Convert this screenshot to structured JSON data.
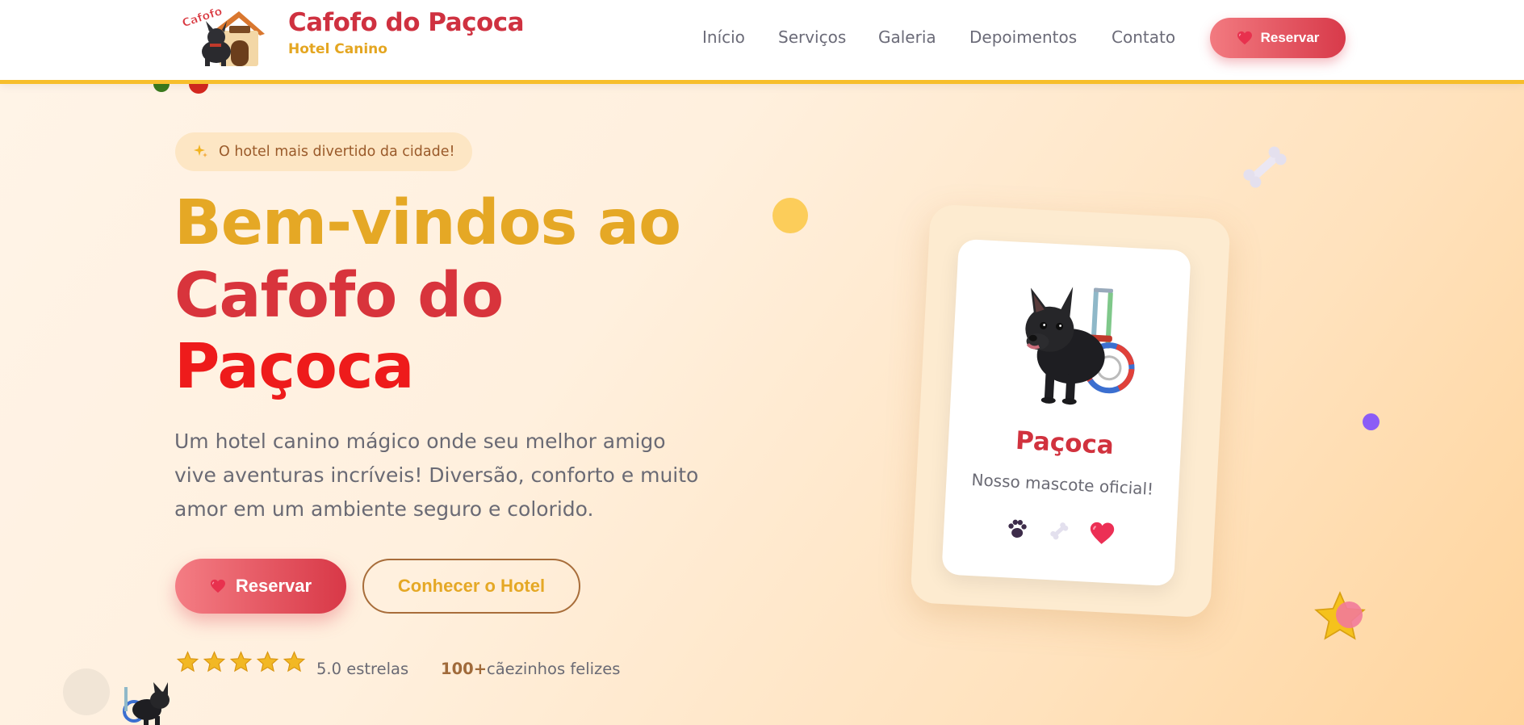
{
  "header": {
    "brand_title": "Cafofo do Paçoca",
    "brand_subtitle": "Hotel Canino",
    "logo_text": "Cafofo",
    "nav": [
      {
        "label": "Início"
      },
      {
        "label": "Serviços"
      },
      {
        "label": "Galeria"
      },
      {
        "label": "Depoimentos"
      },
      {
        "label": "Contato"
      }
    ],
    "reserve_label": "Reservar"
  },
  "hero": {
    "badge_icon": "sparkles-icon",
    "badge_text": "O hotel mais divertido da cidade!",
    "title_line1": "Bem-vindos ao",
    "title_line2": "Cafofo do",
    "title_line3": "Paçoca",
    "lead_line1": "Um hotel canino mágico onde seu melhor amigo",
    "lead_line2": "vive aventuras incríveis! Diversão, conforto e muito",
    "lead_line3": "amor em um ambiente seguro e colorido.",
    "primary_button": "Reservar",
    "secondary_button": "Conhecer o Hotel",
    "rating_stars": 5,
    "rating_text": "5.0 estrelas",
    "happy_count": "100+",
    "happy_text": "cãezinhos felizes"
  },
  "mascot_card": {
    "name": "Paçoca",
    "caption": "Nosso mascote oficial!",
    "icons": [
      "paw-icon",
      "bone-icon",
      "heart-icon"
    ]
  },
  "colors": {
    "brand_red": "#d1323e",
    "brand_yellow": "#e5a825",
    "accent_border": "#f7be2b",
    "bright_red": "#ee1b1b"
  }
}
